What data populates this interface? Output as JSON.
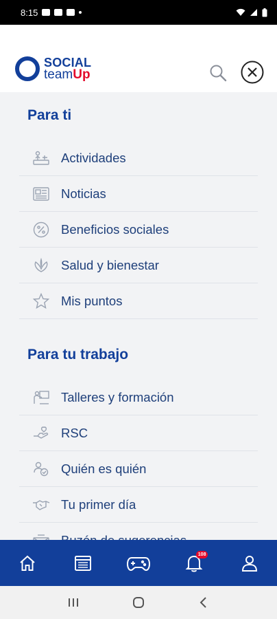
{
  "status_bar": {
    "time": "8:15"
  },
  "header": {
    "logo_line1": "SOCIAL",
    "logo_team": "team",
    "logo_up": "Up"
  },
  "sections": [
    {
      "title": "Para ti",
      "items": [
        {
          "label": "Actividades",
          "icon": "activities-icon"
        },
        {
          "label": "Noticias",
          "icon": "news-icon"
        },
        {
          "label": "Beneficios sociales",
          "icon": "discount-icon"
        },
        {
          "label": "Salud y bienestar",
          "icon": "wellness-icon"
        },
        {
          "label": "Mis puntos",
          "icon": "star-icon"
        }
      ]
    },
    {
      "title": "Para tu trabajo",
      "items": [
        {
          "label": "Talleres y formación",
          "icon": "training-icon"
        },
        {
          "label": "RSC",
          "icon": "csr-icon"
        },
        {
          "label": "Quién es quién",
          "icon": "people-icon"
        },
        {
          "label": "Tu primer día",
          "icon": "handshake-icon"
        },
        {
          "label": "Buzón de sugerencias",
          "icon": "suggestions-icon"
        }
      ]
    }
  ],
  "bottom_nav": {
    "items": [
      "home-icon",
      "calendar-icon",
      "games-icon",
      "notifications-icon",
      "profile-icon"
    ],
    "notification_badge": "108"
  },
  "colors": {
    "brand_blue": "#123f9a",
    "brand_red": "#e30b2b",
    "menu_bg": "#f2f3f5"
  }
}
